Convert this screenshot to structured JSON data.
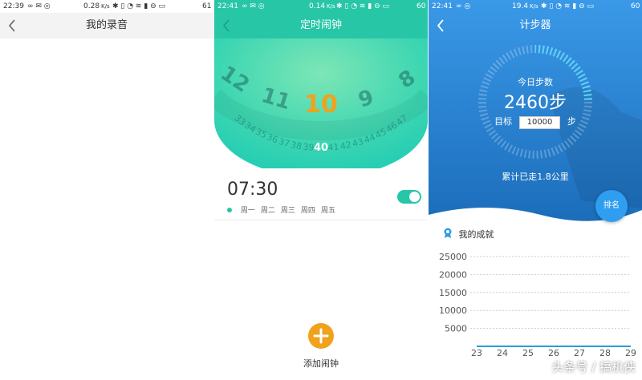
{
  "recording": {
    "status": {
      "time": "22:39",
      "speed": "0.28",
      "speed_unit": "K/s",
      "battery": "61"
    },
    "title": "我的录音"
  },
  "alarm": {
    "status": {
      "time": "22:41",
      "speed": "0.14",
      "speed_unit": "K/s",
      "battery": "60"
    },
    "title": "定时闹钟",
    "dial_hours": [
      "12",
      "11",
      "10",
      "9",
      "8"
    ],
    "selected_hour": "10",
    "dial_minutes_left": [
      "33",
      "34",
      "35",
      "36",
      "37",
      "38",
      "39"
    ],
    "selected_minute": "40",
    "dial_minutes_right": [
      "41",
      "42",
      "43",
      "44",
      "45",
      "46",
      "47"
    ],
    "alarm_time": "07:30",
    "alarm_days": [
      "周一",
      "周二",
      "周三",
      "周四",
      "周五"
    ],
    "alarm_enabled": true,
    "add_label": "添加闹钟",
    "accent": "#27c6a7",
    "highlight": "#f0a21d"
  },
  "pedometer": {
    "status": {
      "time": "22:41",
      "speed": "19.4",
      "speed_unit": "K/s",
      "battery": "60"
    },
    "title": "计步器",
    "today_label": "今日步数",
    "steps": "2460步",
    "target_label": "目标",
    "target_value": "10000",
    "target_unit": "步",
    "distance": "累计已走1.8公里",
    "rank_label": "排名",
    "achievement_title": "我的成就",
    "progress_fraction": 0.246
  },
  "chart_data": {
    "type": "line",
    "title": "",
    "xlabel": "",
    "ylabel": "",
    "x": [
      "23",
      "24",
      "25",
      "26",
      "27",
      "28",
      "29"
    ],
    "yticks": [
      "25000",
      "20000",
      "15000",
      "10000",
      "5000"
    ],
    "ylim": [
      0,
      25000
    ],
    "series": [
      {
        "values": [
          0,
          0,
          0,
          0,
          0,
          0,
          0
        ]
      }
    ],
    "grid": true,
    "line_color": "#2a9be0"
  },
  "watermark": "头条号 / 搞机侠"
}
